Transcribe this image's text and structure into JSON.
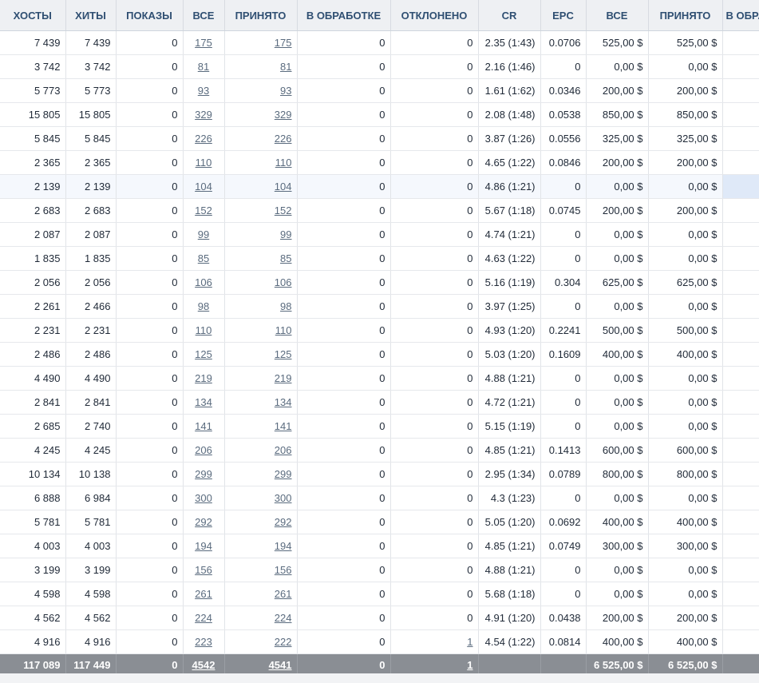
{
  "headers": {
    "hosts": "ХОСТЫ",
    "hits": "ХИТЫ",
    "shows": "ПОКАЗЫ",
    "all": "ВСЕ",
    "accepted": "ПРИНЯТО",
    "processing": "В ОБРАБОТКЕ",
    "rejected": "ОТКЛОНЕНО",
    "cr": "CR",
    "epc": "EPC",
    "sum_all": "ВСЕ",
    "sum_accepted": "ПРИНЯТО",
    "sum_processing": "В ОБРАБОТКЕ"
  },
  "rows": [
    {
      "hosts": "7 439",
      "hits": "7 439",
      "shows": "0",
      "all": "175",
      "accepted": "175",
      "processing": "0",
      "rejected": "0",
      "cr": "2.35 (1:43)",
      "epc": "0.0706",
      "sum_all": "525,00 $",
      "sum_accepted": "525,00 $"
    },
    {
      "hosts": "3 742",
      "hits": "3 742",
      "shows": "0",
      "all": "81",
      "accepted": "81",
      "processing": "0",
      "rejected": "0",
      "cr": "2.16 (1:46)",
      "epc": "0",
      "sum_all": "0,00 $",
      "sum_accepted": "0,00 $"
    },
    {
      "hosts": "5 773",
      "hits": "5 773",
      "shows": "0",
      "all": "93",
      "accepted": "93",
      "processing": "0",
      "rejected": "0",
      "cr": "1.61 (1:62)",
      "epc": "0.0346",
      "sum_all": "200,00 $",
      "sum_accepted": "200,00 $"
    },
    {
      "hosts": "15 805",
      "hits": "15 805",
      "shows": "0",
      "all": "329",
      "accepted": "329",
      "processing": "0",
      "rejected": "0",
      "cr": "2.08 (1:48)",
      "epc": "0.0538",
      "sum_all": "850,00 $",
      "sum_accepted": "850,00 $"
    },
    {
      "hosts": "5 845",
      "hits": "5 845",
      "shows": "0",
      "all": "226",
      "accepted": "226",
      "processing": "0",
      "rejected": "0",
      "cr": "3.87 (1:26)",
      "epc": "0.0556",
      "sum_all": "325,00 $",
      "sum_accepted": "325,00 $"
    },
    {
      "hosts": "2 365",
      "hits": "2 365",
      "shows": "0",
      "all": "110",
      "accepted": "110",
      "processing": "0",
      "rejected": "0",
      "cr": "4.65 (1:22)",
      "epc": "0.0846",
      "sum_all": "200,00 $",
      "sum_accepted": "200,00 $"
    },
    {
      "hosts": "2 139",
      "hits": "2 139",
      "shows": "0",
      "all": "104",
      "accepted": "104",
      "processing": "0",
      "rejected": "0",
      "cr": "4.86 (1:21)",
      "epc": "0",
      "sum_all": "0,00 $",
      "sum_accepted": "0,00 $",
      "highlight": true
    },
    {
      "hosts": "2 683",
      "hits": "2 683",
      "shows": "0",
      "all": "152",
      "accepted": "152",
      "processing": "0",
      "rejected": "0",
      "cr": "5.67 (1:18)",
      "epc": "0.0745",
      "sum_all": "200,00 $",
      "sum_accepted": "200,00 $"
    },
    {
      "hosts": "2 087",
      "hits": "2 087",
      "shows": "0",
      "all": "99",
      "accepted": "99",
      "processing": "0",
      "rejected": "0",
      "cr": "4.74 (1:21)",
      "epc": "0",
      "sum_all": "0,00 $",
      "sum_accepted": "0,00 $"
    },
    {
      "hosts": "1 835",
      "hits": "1 835",
      "shows": "0",
      "all": "85",
      "accepted": "85",
      "processing": "0",
      "rejected": "0",
      "cr": "4.63 (1:22)",
      "epc": "0",
      "sum_all": "0,00 $",
      "sum_accepted": "0,00 $"
    },
    {
      "hosts": "2 056",
      "hits": "2 056",
      "shows": "0",
      "all": "106",
      "accepted": "106",
      "processing": "0",
      "rejected": "0",
      "cr": "5.16 (1:19)",
      "epc": "0.304",
      "sum_all": "625,00 $",
      "sum_accepted": "625,00 $"
    },
    {
      "hosts": "2 261",
      "hits": "2 466",
      "shows": "0",
      "all": "98",
      "accepted": "98",
      "processing": "0",
      "rejected": "0",
      "cr": "3.97 (1:25)",
      "epc": "0",
      "sum_all": "0,00 $",
      "sum_accepted": "0,00 $"
    },
    {
      "hosts": "2 231",
      "hits": "2 231",
      "shows": "0",
      "all": "110",
      "accepted": "110",
      "processing": "0",
      "rejected": "0",
      "cr": "4.93 (1:20)",
      "epc": "0.2241",
      "sum_all": "500,00 $",
      "sum_accepted": "500,00 $"
    },
    {
      "hosts": "2 486",
      "hits": "2 486",
      "shows": "0",
      "all": "125",
      "accepted": "125",
      "processing": "0",
      "rejected": "0",
      "cr": "5.03 (1:20)",
      "epc": "0.1609",
      "sum_all": "400,00 $",
      "sum_accepted": "400,00 $"
    },
    {
      "hosts": "4 490",
      "hits": "4 490",
      "shows": "0",
      "all": "219",
      "accepted": "219",
      "processing": "0",
      "rejected": "0",
      "cr": "4.88 (1:21)",
      "epc": "0",
      "sum_all": "0,00 $",
      "sum_accepted": "0,00 $"
    },
    {
      "hosts": "2 841",
      "hits": "2 841",
      "shows": "0",
      "all": "134",
      "accepted": "134",
      "processing": "0",
      "rejected": "0",
      "cr": "4.72 (1:21)",
      "epc": "0",
      "sum_all": "0,00 $",
      "sum_accepted": "0,00 $"
    },
    {
      "hosts": "2 685",
      "hits": "2 740",
      "shows": "0",
      "all": "141",
      "accepted": "141",
      "processing": "0",
      "rejected": "0",
      "cr": "5.15 (1:19)",
      "epc": "0",
      "sum_all": "0,00 $",
      "sum_accepted": "0,00 $"
    },
    {
      "hosts": "4 245",
      "hits": "4 245",
      "shows": "0",
      "all": "206",
      "accepted": "206",
      "processing": "0",
      "rejected": "0",
      "cr": "4.85 (1:21)",
      "epc": "0.1413",
      "sum_all": "600,00 $",
      "sum_accepted": "600,00 $"
    },
    {
      "hosts": "10 134",
      "hits": "10 138",
      "shows": "0",
      "all": "299",
      "accepted": "299",
      "processing": "0",
      "rejected": "0",
      "cr": "2.95 (1:34)",
      "epc": "0.0789",
      "sum_all": "800,00 $",
      "sum_accepted": "800,00 $"
    },
    {
      "hosts": "6 888",
      "hits": "6 984",
      "shows": "0",
      "all": "300",
      "accepted": "300",
      "processing": "0",
      "rejected": "0",
      "cr": "4.3 (1:23)",
      "epc": "0",
      "sum_all": "0,00 $",
      "sum_accepted": "0,00 $"
    },
    {
      "hosts": "5 781",
      "hits": "5 781",
      "shows": "0",
      "all": "292",
      "accepted": "292",
      "processing": "0",
      "rejected": "0",
      "cr": "5.05 (1:20)",
      "epc": "0.0692",
      "sum_all": "400,00 $",
      "sum_accepted": "400,00 $"
    },
    {
      "hosts": "4 003",
      "hits": "4 003",
      "shows": "0",
      "all": "194",
      "accepted": "194",
      "processing": "0",
      "rejected": "0",
      "cr": "4.85 (1:21)",
      "epc": "0.0749",
      "sum_all": "300,00 $",
      "sum_accepted": "300,00 $"
    },
    {
      "hosts": "3 199",
      "hits": "3 199",
      "shows": "0",
      "all": "156",
      "accepted": "156",
      "processing": "0",
      "rejected": "0",
      "cr": "4.88 (1:21)",
      "epc": "0",
      "sum_all": "0,00 $",
      "sum_accepted": "0,00 $"
    },
    {
      "hosts": "4 598",
      "hits": "4 598",
      "shows": "0",
      "all": "261",
      "accepted": "261",
      "processing": "0",
      "rejected": "0",
      "cr": "5.68 (1:18)",
      "epc": "0",
      "sum_all": "0,00 $",
      "sum_accepted": "0,00 $"
    },
    {
      "hosts": "4 562",
      "hits": "4 562",
      "shows": "0",
      "all": "224",
      "accepted": "224",
      "processing": "0",
      "rejected": "0",
      "cr": "4.91 (1:20)",
      "epc": "0.0438",
      "sum_all": "200,00 $",
      "sum_accepted": "200,00 $"
    },
    {
      "hosts": "4 916",
      "hits": "4 916",
      "shows": "0",
      "all": "223",
      "accepted": "222",
      "processing": "0",
      "rejected": "1",
      "cr": "4.54 (1:22)",
      "epc": "0.0814",
      "sum_all": "400,00 $",
      "sum_accepted": "400,00 $",
      "rejected_link": true
    }
  ],
  "totals": {
    "hosts": "117 089",
    "hits": "117 449",
    "shows": "0",
    "all": "4542",
    "accepted": "4541",
    "processing": "0",
    "rejected": "1",
    "cr": "",
    "epc": "",
    "sum_all": "6 525,00 $",
    "sum_accepted": "6 525,00 $"
  },
  "colors": {
    "header_bg": "#eef0f3",
    "header_text": "#2f4f72",
    "link": "#5a6b7e",
    "totals_bg": "#8a8e94",
    "highlight_row": "#f5f8fd",
    "highlight_cell": "#dfe9f8"
  }
}
